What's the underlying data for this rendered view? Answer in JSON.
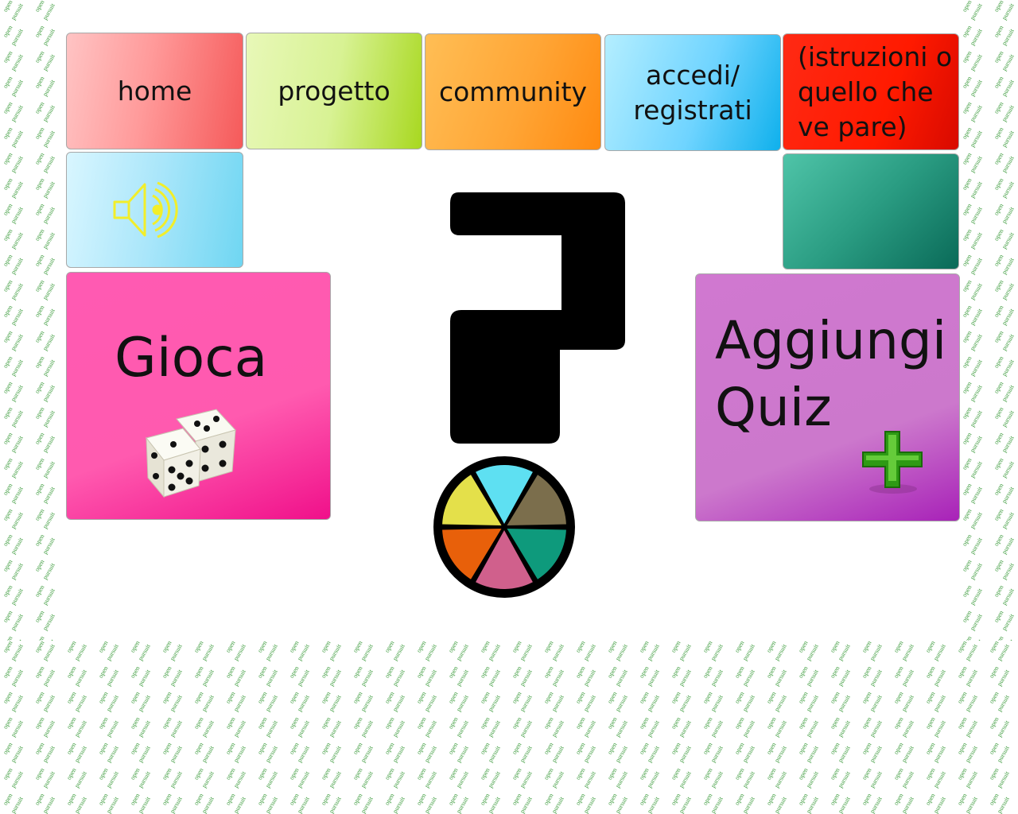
{
  "watermark": {
    "line1": "open",
    "line2": "pursuit",
    "color": "#3a9a3a"
  },
  "nav": {
    "home": "home",
    "progetto": "progetto",
    "community": "community",
    "accedi_line1": "accedi/",
    "accedi_line2": "registrati",
    "istruzioni_line1": "(istruzioni o",
    "istruzioni_line2": "quello che",
    "istruzioni_line3": "ve pare)"
  },
  "main": {
    "gioca": "Gioca",
    "aggiungi_line1": "Aggiungi",
    "aggiungi_line2": "Quiz"
  },
  "icons": {
    "audio": "speaker-icon",
    "gioca": "dice-icon",
    "aggiungi": "plus-icon",
    "logo": "question-mark-icon",
    "wheel": "trivia-wheel-icon"
  },
  "colors": {
    "home": "#ff9a9a",
    "progetto": "#d8f294",
    "community": "#ffa535",
    "accedi": "#6fd4ff",
    "istruzioni": "#ff1a00",
    "audio": "#a9e6fa",
    "green_tile": "#2a9c82",
    "gioca": "#ff5aaf",
    "aggiungi": "#cc78cc",
    "wheel": [
      "#5ee0f2",
      "#7b6e4c",
      "#0e9a7c",
      "#d0608c",
      "#e8600a",
      "#e4e04a"
    ]
  }
}
